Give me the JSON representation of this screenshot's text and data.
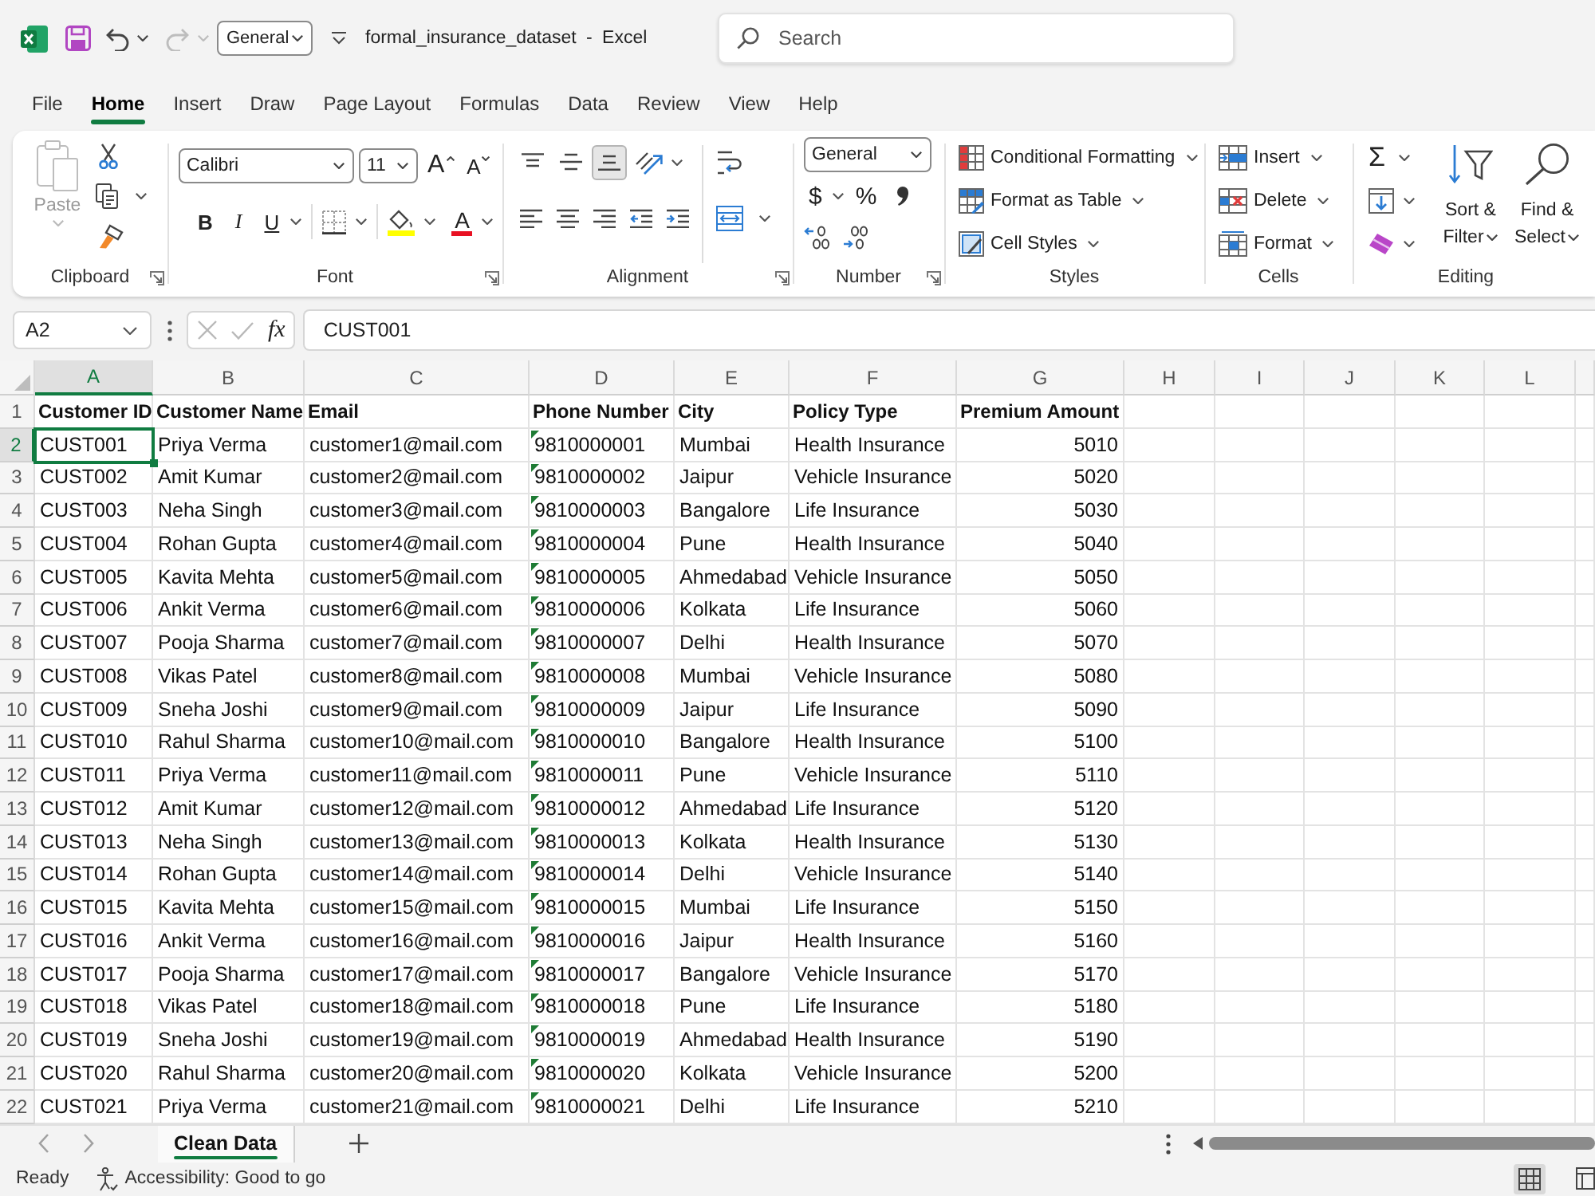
{
  "title_bar": {
    "quick_access": [
      {
        "kind": "save",
        "disabled": false
      },
      {
        "kind": "undo",
        "disabled": false
      },
      {
        "kind": "redo",
        "disabled": true
      }
    ],
    "number_format": "General",
    "document_title": "formal_insurance_dataset - Excel",
    "search": {
      "placeholder": "Search"
    }
  },
  "menu_tabs": [
    {
      "label": "File",
      "selected": false
    },
    {
      "label": "Home",
      "selected": true
    },
    {
      "label": "Insert",
      "selected": false
    },
    {
      "label": "Draw",
      "selected": false
    },
    {
      "label": "Page Layout",
      "selected": false
    },
    {
      "label": "Formulas",
      "selected": false
    },
    {
      "label": "Data",
      "selected": false
    },
    {
      "label": "Review",
      "selected": false
    },
    {
      "label": "View",
      "selected": false
    },
    {
      "label": "Help",
      "selected": false
    }
  ],
  "ribbon": {
    "clipboard": {
      "label": "Clipboard",
      "paste": {
        "label": "Paste",
        "disabled": true
      }
    },
    "font": {
      "label": "Font",
      "font_name": "Calibri",
      "font_size": "11",
      "grow_font": "A",
      "shrink_font": "A",
      "bold": "B",
      "italic": "I",
      "underline": "U",
      "font_color": "A"
    },
    "alignment": {
      "label": "Alignment",
      "vertical": [
        {
          "kind": "top",
          "selected": false
        },
        {
          "kind": "middle",
          "selected": false
        },
        {
          "kind": "bottom",
          "selected": true
        }
      ]
    },
    "number": {
      "label": "Number",
      "format": "General",
      "currency": "$",
      "percent": "%"
    },
    "styles": {
      "label": "Styles",
      "buttons": [
        {
          "kind": "conditional",
          "label": "Conditional Formatting"
        },
        {
          "kind": "table",
          "label": "Format as Table"
        },
        {
          "kind": "styles",
          "label": "Cell Styles"
        }
      ]
    },
    "cells": {
      "label": "Cells",
      "buttons": [
        {
          "kind": "insert",
          "label": "Insert"
        },
        {
          "kind": "delete",
          "label": "Delete"
        },
        {
          "kind": "format",
          "label": "Format"
        }
      ]
    },
    "editing": {
      "label": "Editing",
      "autosum": "Σ",
      "sort_filter": "Sort & Filter",
      "find_select": "Find & Select"
    }
  },
  "formula_bar": {
    "name_box": "A2",
    "function_label": "fx",
    "formula": "CUST001"
  },
  "sheet": {
    "columns": [
      {
        "letter": "A",
        "selected": true,
        "kind": "text"
      },
      {
        "letter": "B",
        "selected": false,
        "kind": "text"
      },
      {
        "letter": "C",
        "selected": false,
        "kind": "text"
      },
      {
        "letter": "D",
        "selected": false,
        "kind": "textnumber"
      },
      {
        "letter": "E",
        "selected": false,
        "kind": "text"
      },
      {
        "letter": "F",
        "selected": false,
        "kind": "text"
      },
      {
        "letter": "G",
        "selected": false,
        "kind": "number"
      },
      {
        "letter": "H",
        "selected": false,
        "kind": "text"
      },
      {
        "letter": "I",
        "selected": false,
        "kind": "text"
      },
      {
        "letter": "J",
        "selected": false,
        "kind": "text"
      },
      {
        "letter": "K",
        "selected": false,
        "kind": "text"
      },
      {
        "letter": "L",
        "selected": false,
        "kind": "text"
      }
    ],
    "rows": [
      {
        "number": "1",
        "selected": false,
        "kind": "header",
        "cells": [
          "Customer ID",
          "Customer Name",
          "Email",
          "Phone Number",
          "City",
          "Policy Type",
          "Premium Amount"
        ]
      },
      {
        "number": "2",
        "selected": true,
        "kind": "data",
        "cells": [
          "CUST001",
          "Priya Verma",
          "customer1@mail.com",
          "9810000001",
          "Mumbai",
          "Health Insurance",
          "5010"
        ]
      },
      {
        "number": "3",
        "selected": false,
        "kind": "data",
        "cells": [
          "CUST002",
          "Amit Kumar",
          "customer2@mail.com",
          "9810000002",
          "Jaipur",
          "Vehicle Insurance",
          "5020"
        ]
      },
      {
        "number": "4",
        "selected": false,
        "kind": "data",
        "cells": [
          "CUST003",
          "Neha Singh",
          "customer3@mail.com",
          "9810000003",
          "Bangalore",
          "Life Insurance",
          "5030"
        ]
      },
      {
        "number": "5",
        "selected": false,
        "kind": "data",
        "cells": [
          "CUST004",
          "Rohan Gupta",
          "customer4@mail.com",
          "9810000004",
          "Pune",
          "Health Insurance",
          "5040"
        ]
      },
      {
        "number": "6",
        "selected": false,
        "kind": "data",
        "cells": [
          "CUST005",
          "Kavita Mehta",
          "customer5@mail.com",
          "9810000005",
          "Ahmedabad",
          "Vehicle Insurance",
          "5050"
        ]
      },
      {
        "number": "7",
        "selected": false,
        "kind": "data",
        "cells": [
          "CUST006",
          "Ankit Verma",
          "customer6@mail.com",
          "9810000006",
          "Kolkata",
          "Life Insurance",
          "5060"
        ]
      },
      {
        "number": "8",
        "selected": false,
        "kind": "data",
        "cells": [
          "CUST007",
          "Pooja Sharma",
          "customer7@mail.com",
          "9810000007",
          "Delhi",
          "Health Insurance",
          "5070"
        ]
      },
      {
        "number": "9",
        "selected": false,
        "kind": "data",
        "cells": [
          "CUST008",
          "Vikas Patel",
          "customer8@mail.com",
          "9810000008",
          "Mumbai",
          "Vehicle Insurance",
          "5080"
        ]
      },
      {
        "number": "10",
        "selected": false,
        "kind": "data",
        "cells": [
          "CUST009",
          "Sneha Joshi",
          "customer9@mail.com",
          "9810000009",
          "Jaipur",
          "Life Insurance",
          "5090"
        ]
      },
      {
        "number": "11",
        "selected": false,
        "kind": "data",
        "cells": [
          "CUST010",
          "Rahul Sharma",
          "customer10@mail.com",
          "9810000010",
          "Bangalore",
          "Health Insurance",
          "5100"
        ]
      },
      {
        "number": "12",
        "selected": false,
        "kind": "data",
        "cells": [
          "CUST011",
          "Priya Verma",
          "customer11@mail.com",
          "9810000011",
          "Pune",
          "Vehicle Insurance",
          "5110"
        ]
      },
      {
        "number": "13",
        "selected": false,
        "kind": "data",
        "cells": [
          "CUST012",
          "Amit Kumar",
          "customer12@mail.com",
          "9810000012",
          "Ahmedabad",
          "Life Insurance",
          "5120"
        ]
      },
      {
        "number": "14",
        "selected": false,
        "kind": "data",
        "cells": [
          "CUST013",
          "Neha Singh",
          "customer13@mail.com",
          "9810000013",
          "Kolkata",
          "Health Insurance",
          "5130"
        ]
      },
      {
        "number": "15",
        "selected": false,
        "kind": "data",
        "cells": [
          "CUST014",
          "Rohan Gupta",
          "customer14@mail.com",
          "9810000014",
          "Delhi",
          "Vehicle Insurance",
          "5140"
        ]
      },
      {
        "number": "16",
        "selected": false,
        "kind": "data",
        "cells": [
          "CUST015",
          "Kavita Mehta",
          "customer15@mail.com",
          "9810000015",
          "Mumbai",
          "Life Insurance",
          "5150"
        ]
      },
      {
        "number": "17",
        "selected": false,
        "kind": "data",
        "cells": [
          "CUST016",
          "Ankit Verma",
          "customer16@mail.com",
          "9810000016",
          "Jaipur",
          "Health Insurance",
          "5160"
        ]
      },
      {
        "number": "18",
        "selected": false,
        "kind": "data",
        "cells": [
          "CUST017",
          "Pooja Sharma",
          "customer17@mail.com",
          "9810000017",
          "Bangalore",
          "Vehicle Insurance",
          "5170"
        ]
      },
      {
        "number": "19",
        "selected": false,
        "kind": "data",
        "cells": [
          "CUST018",
          "Vikas Patel",
          "customer18@mail.com",
          "9810000018",
          "Pune",
          "Life Insurance",
          "5180"
        ]
      },
      {
        "number": "20",
        "selected": false,
        "kind": "data",
        "cells": [
          "CUST019",
          "Sneha Joshi",
          "customer19@mail.com",
          "9810000019",
          "Ahmedabad",
          "Health Insurance",
          "5190"
        ]
      },
      {
        "number": "21",
        "selected": false,
        "kind": "data",
        "cells": [
          "CUST020",
          "Rahul Sharma",
          "customer20@mail.com",
          "9810000020",
          "Kolkata",
          "Vehicle Insurance",
          "5200"
        ]
      },
      {
        "number": "22",
        "selected": false,
        "kind": "data",
        "cells": [
          "CUST021",
          "Priya Verma",
          "customer21@mail.com",
          "9810000021",
          "Delhi",
          "Life Insurance",
          "5210"
        ]
      }
    ]
  },
  "sheet_tabs": [
    {
      "label": "Clean Data",
      "selected": true
    }
  ],
  "status_bar": {
    "status": "Ready",
    "accessibility": "Accessibility: Good to go",
    "views": [
      {
        "kind": "normal",
        "selected": true
      },
      {
        "kind": "page_layout",
        "selected": false
      }
    ]
  }
}
